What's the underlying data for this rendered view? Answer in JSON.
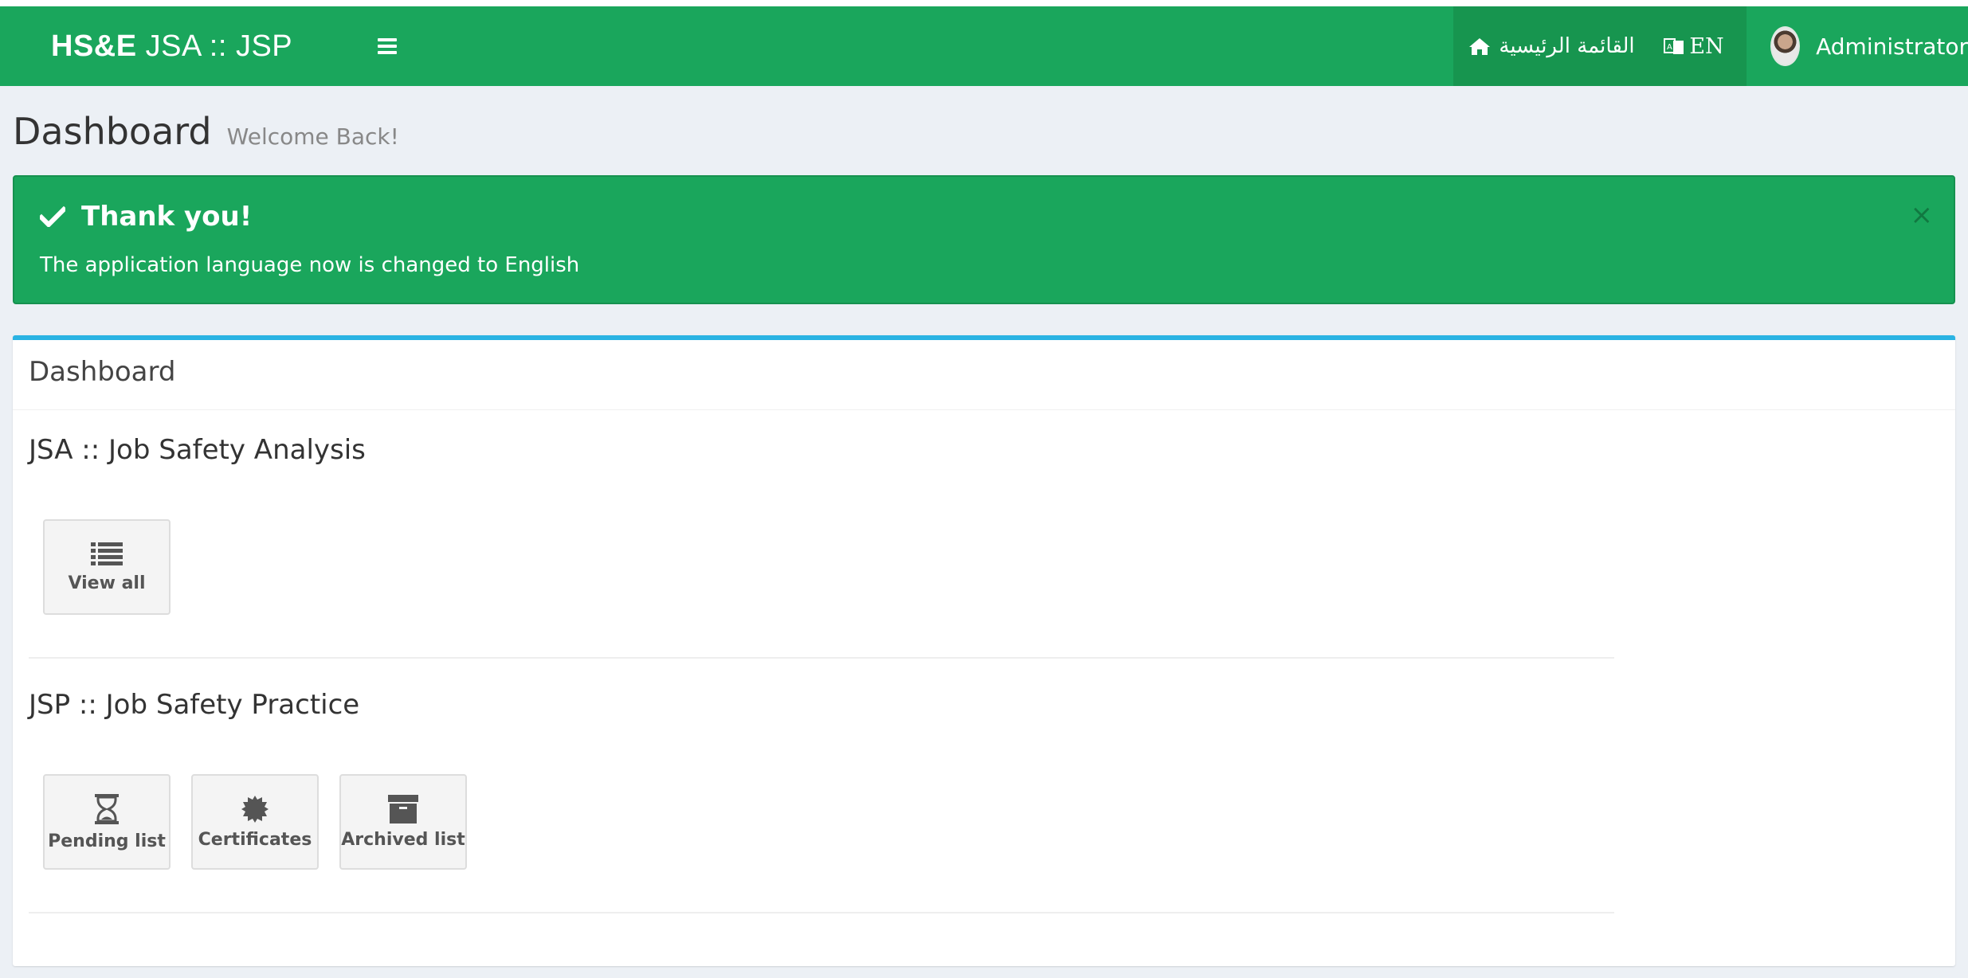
{
  "navbar": {
    "brand_bold": "HS&E",
    "brand_light": "JSA :: JSP",
    "home_label": "القائمة الرئيسية",
    "lang_label": "EN",
    "user_name": "Administrator",
    "color": "#1aa65c"
  },
  "header": {
    "title": "Dashboard",
    "subtitle": "Welcome Back!"
  },
  "alert": {
    "title": "Thank you!",
    "message": "The application language now is changed to English",
    "close": "×",
    "icon": "check-icon"
  },
  "box": {
    "title": "Dashboard",
    "accent": "#2ab3e3",
    "sections": [
      {
        "title": "JSA :: Job Safety Analysis",
        "tiles": [
          {
            "label": "View all",
            "icon": "list-icon"
          }
        ]
      },
      {
        "title": "JSP :: Job Safety Practice",
        "tiles": [
          {
            "label": "Pending list",
            "icon": "hourglass-icon"
          },
          {
            "label": "Certificates",
            "icon": "certificate-icon"
          },
          {
            "label": "Archived list",
            "icon": "archive-icon"
          }
        ]
      }
    ]
  }
}
